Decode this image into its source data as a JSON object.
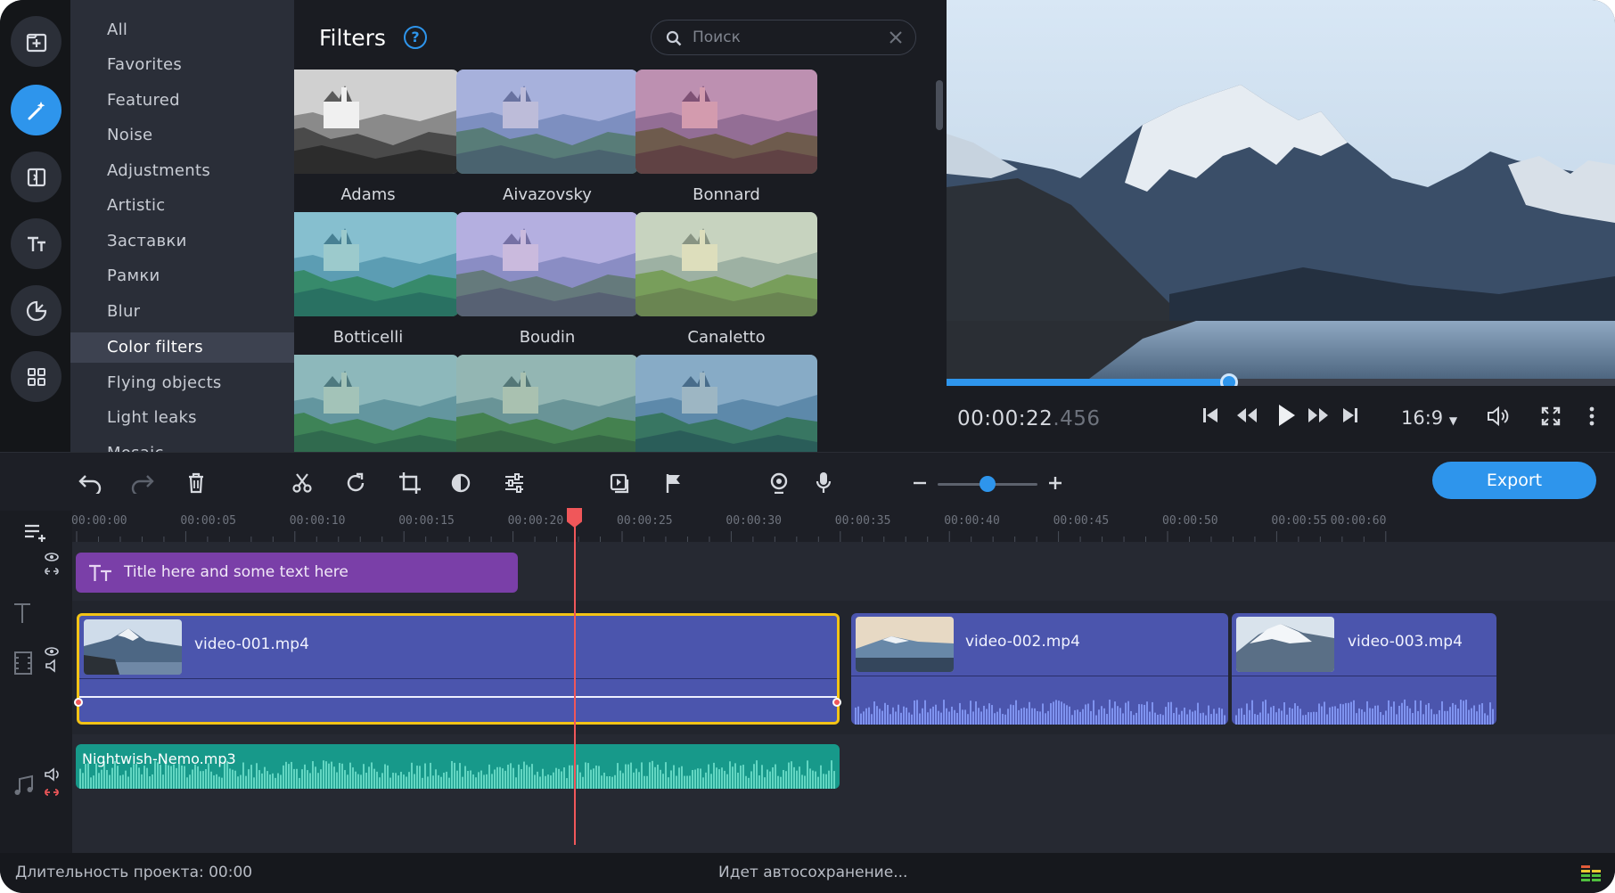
{
  "sidebar_rail": {
    "items": [
      {
        "name": "import-icon"
      },
      {
        "name": "magic-wand-icon",
        "active": true
      },
      {
        "name": "transitions-icon"
      },
      {
        "name": "titles-icon"
      },
      {
        "name": "stickers-icon"
      },
      {
        "name": "more-tools-icon"
      }
    ]
  },
  "categories": [
    "All",
    "Favorites",
    "Featured",
    "Noise",
    "Adjustments",
    "Artistic",
    "Заставки",
    "Рамки",
    "Blur",
    "Color filters",
    "Flying objects",
    "Light leaks",
    "Mosaic"
  ],
  "selected_category": "Color filters",
  "filters_panel": {
    "title": "Filters",
    "help": "?",
    "search_placeholder": "Поиск",
    "items": [
      {
        "label": "Adams",
        "tint": "grayscale"
      },
      {
        "label": "Aivazovsky",
        "tint": "#7c7fd0"
      },
      {
        "label": "Bonnard",
        "tint": "#b0306a"
      },
      {
        "label": "Botticelli",
        "tint": "#2e9fb0"
      },
      {
        "label": "Boudin",
        "tint": "#9a7ad8"
      },
      {
        "label": "Canaletto",
        "tint": "#c8d08a"
      },
      {
        "label": "",
        "tint": "#3d8f80"
      },
      {
        "label": "",
        "tint": "#4c8a6e"
      },
      {
        "label": "",
        "tint": "#2f6f9a"
      }
    ]
  },
  "player": {
    "timecode_main": "00:00:22",
    "timecode_ms": ".456",
    "aspect": "16:9",
    "progress": 0.423
  },
  "toolbar": {
    "export_label": "Export"
  },
  "timeline": {
    "ruler_labels": [
      "00:00:00",
      "00:00:05",
      "00:00:10",
      "00:00:15",
      "00:00:20",
      "00:00:25",
      "00:00:30",
      "00:00:35",
      "00:00:40",
      "00:00:45",
      "00:00:50",
      "00:00:55",
      "00:00:60"
    ],
    "title_clip": "Title here and some text here",
    "video_clips": [
      "video-001.mp4",
      "video-002.mp4",
      "video-003.mp4"
    ],
    "audio_clip": "Nightwish-Nemo.mp3"
  },
  "status": {
    "duration": "Длительность проекта: 00:00",
    "autosave": "Идет автосохранение..."
  },
  "colors": {
    "accent": "#2e95ec",
    "title_clip": "#7a3fa8",
    "video_clip": "#4b55ad",
    "audio_clip": "#17998a",
    "playhead": "#f0575a",
    "selection": "#f3c316"
  }
}
